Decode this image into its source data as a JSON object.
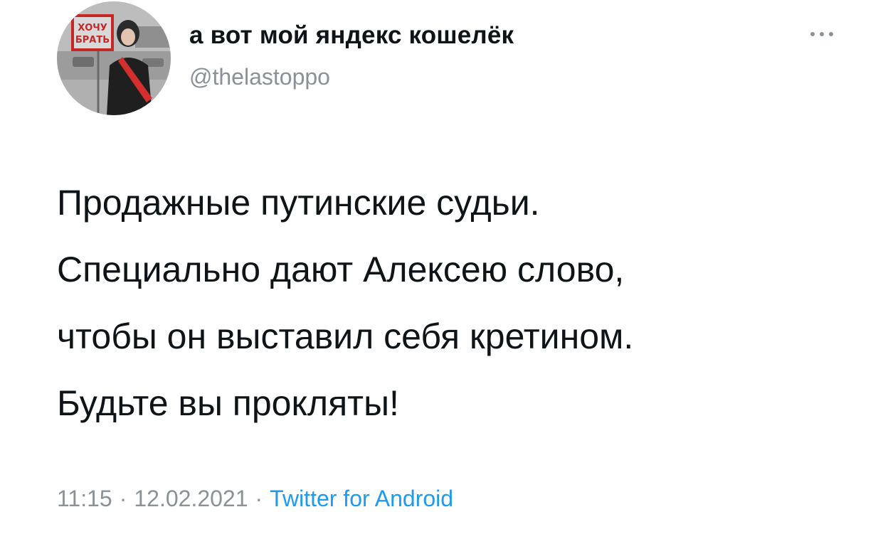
{
  "author": {
    "name": "а вот мой яндекс кошелёк",
    "handle": "@thelastoppo",
    "avatar_sign_text": "ХОЧУ БРАТЬ"
  },
  "menu": {
    "icon": "more-horizontal-icon"
  },
  "tweet": {
    "lines": [
      "Продажные путинские судьи.",
      "Специально дают Алексею слово,",
      "чтобы он выставил себя кретином.",
      "Будьте вы прокляты!"
    ]
  },
  "meta": {
    "time": "11:15",
    "separator": "·",
    "date": "12.02.2021",
    "source": "Twitter for Android"
  },
  "colors": {
    "text": "#0f1419",
    "secondary": "#8a9199",
    "link": "#1d9bf0"
  }
}
